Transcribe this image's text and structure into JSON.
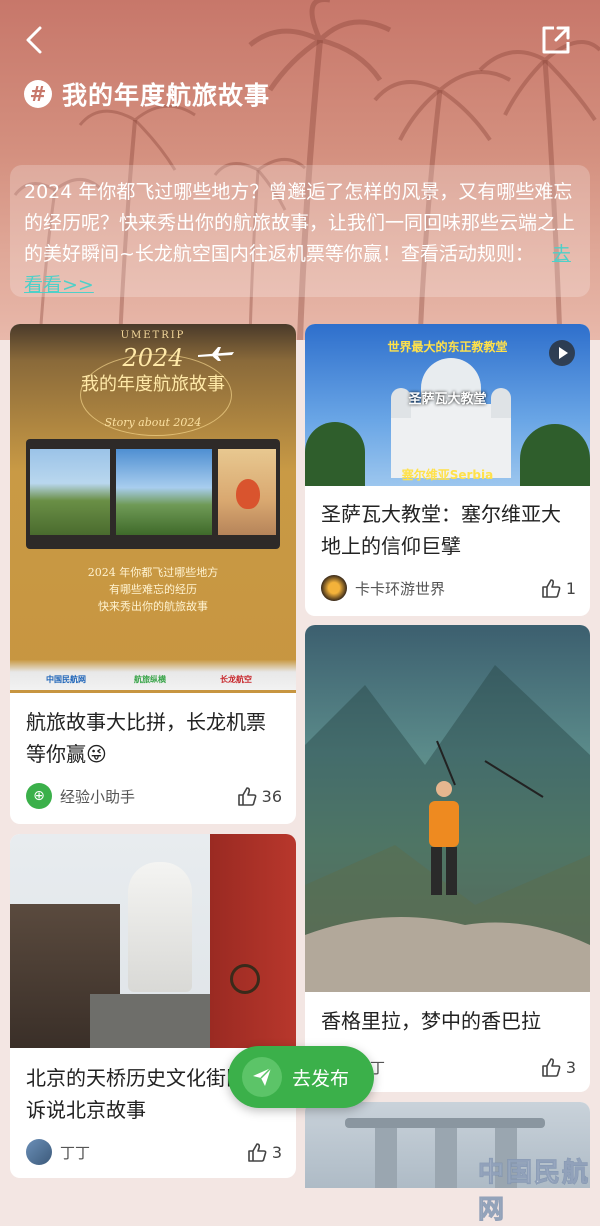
{
  "header": {
    "title": "我的年度航旅故事",
    "intro_text": "2024 年你都飞过哪些地方？曾邂逅了怎样的风景，又有哪些难忘的经历呢？快来秀出你的航旅故事，让我们一同回味那些云端之上的美好瞬间~长龙航空国内往返机票等你赢！查看活动规则：",
    "rules_link": "去看看>>"
  },
  "poster": {
    "brand": "UMETRIP",
    "year": "2024",
    "headline": "我的年度航旅故事",
    "subtitle": "Story about 2024",
    "line1": "2024 年你都飞过哪些地方",
    "line2": "有哪些难忘的经历",
    "line3": "快来秀出你的航旅故事",
    "logo1": "中国民航网",
    "logo2": "航旅纵横",
    "logo3": "长龙航空"
  },
  "posts": [
    {
      "title": "航旅故事大比拼，长龙机票等你赢😜",
      "author": "经验小助手",
      "likes": "36"
    },
    {
      "title": "北京的天桥历史文化街区，诉说北京故事",
      "author": "丁丁",
      "likes": "3"
    },
    {
      "title": "圣萨瓦大教堂：塞尔维亚大地上的信仰巨擘",
      "author": "卡卡环游世界",
      "likes": "1",
      "image_caption_top": "世界最大的东正教教堂",
      "image_caption_mid": "圣萨瓦大教堂",
      "image_caption_bottom": "塞尔维亚Serbia"
    },
    {
      "title": "香格里拉，梦中的香巴拉",
      "author": "丁丁",
      "likes": "3"
    }
  ],
  "fab": {
    "label": "去发布"
  },
  "watermark": "中国民航网",
  "colors": {
    "accent_green": "#3bb04a",
    "link_teal": "#4fd0c8",
    "hero": "#c7776a"
  }
}
